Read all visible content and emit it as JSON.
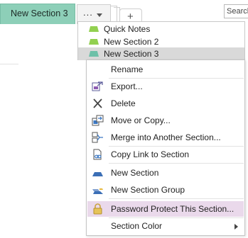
{
  "tabs": {
    "active_label": "New Section 3",
    "more_label": "...",
    "add_label": "+"
  },
  "search": {
    "placeholder": "Search"
  },
  "section_list": [
    {
      "label": "Quick Notes",
      "color": "#92d050",
      "selected": false
    },
    {
      "label": "New Section 2",
      "color": "#92d050",
      "selected": false
    },
    {
      "label": "New Section 3",
      "color": "#6dc0a8",
      "selected": true
    }
  ],
  "context_menu": {
    "items": [
      {
        "label": "Rename",
        "icon": "none"
      },
      {
        "label": "Export...",
        "icon": "export-icon"
      },
      {
        "label": "Delete",
        "icon": "delete-icon"
      },
      {
        "label": "Move or Copy...",
        "icon": "move-copy-icon"
      },
      {
        "label": "Merge into Another Section...",
        "icon": "merge-icon"
      },
      {
        "label": "Copy Link to Section",
        "icon": "copy-link-icon"
      },
      {
        "label": "New Section",
        "icon": "new-section-icon"
      },
      {
        "label": "New Section Group",
        "icon": "new-section-group-icon"
      },
      {
        "label": "Password Protect This Section...",
        "icon": "lock-icon",
        "highlighted": true
      },
      {
        "label": "Section Color",
        "icon": "none",
        "has_submenu": true
      }
    ]
  }
}
